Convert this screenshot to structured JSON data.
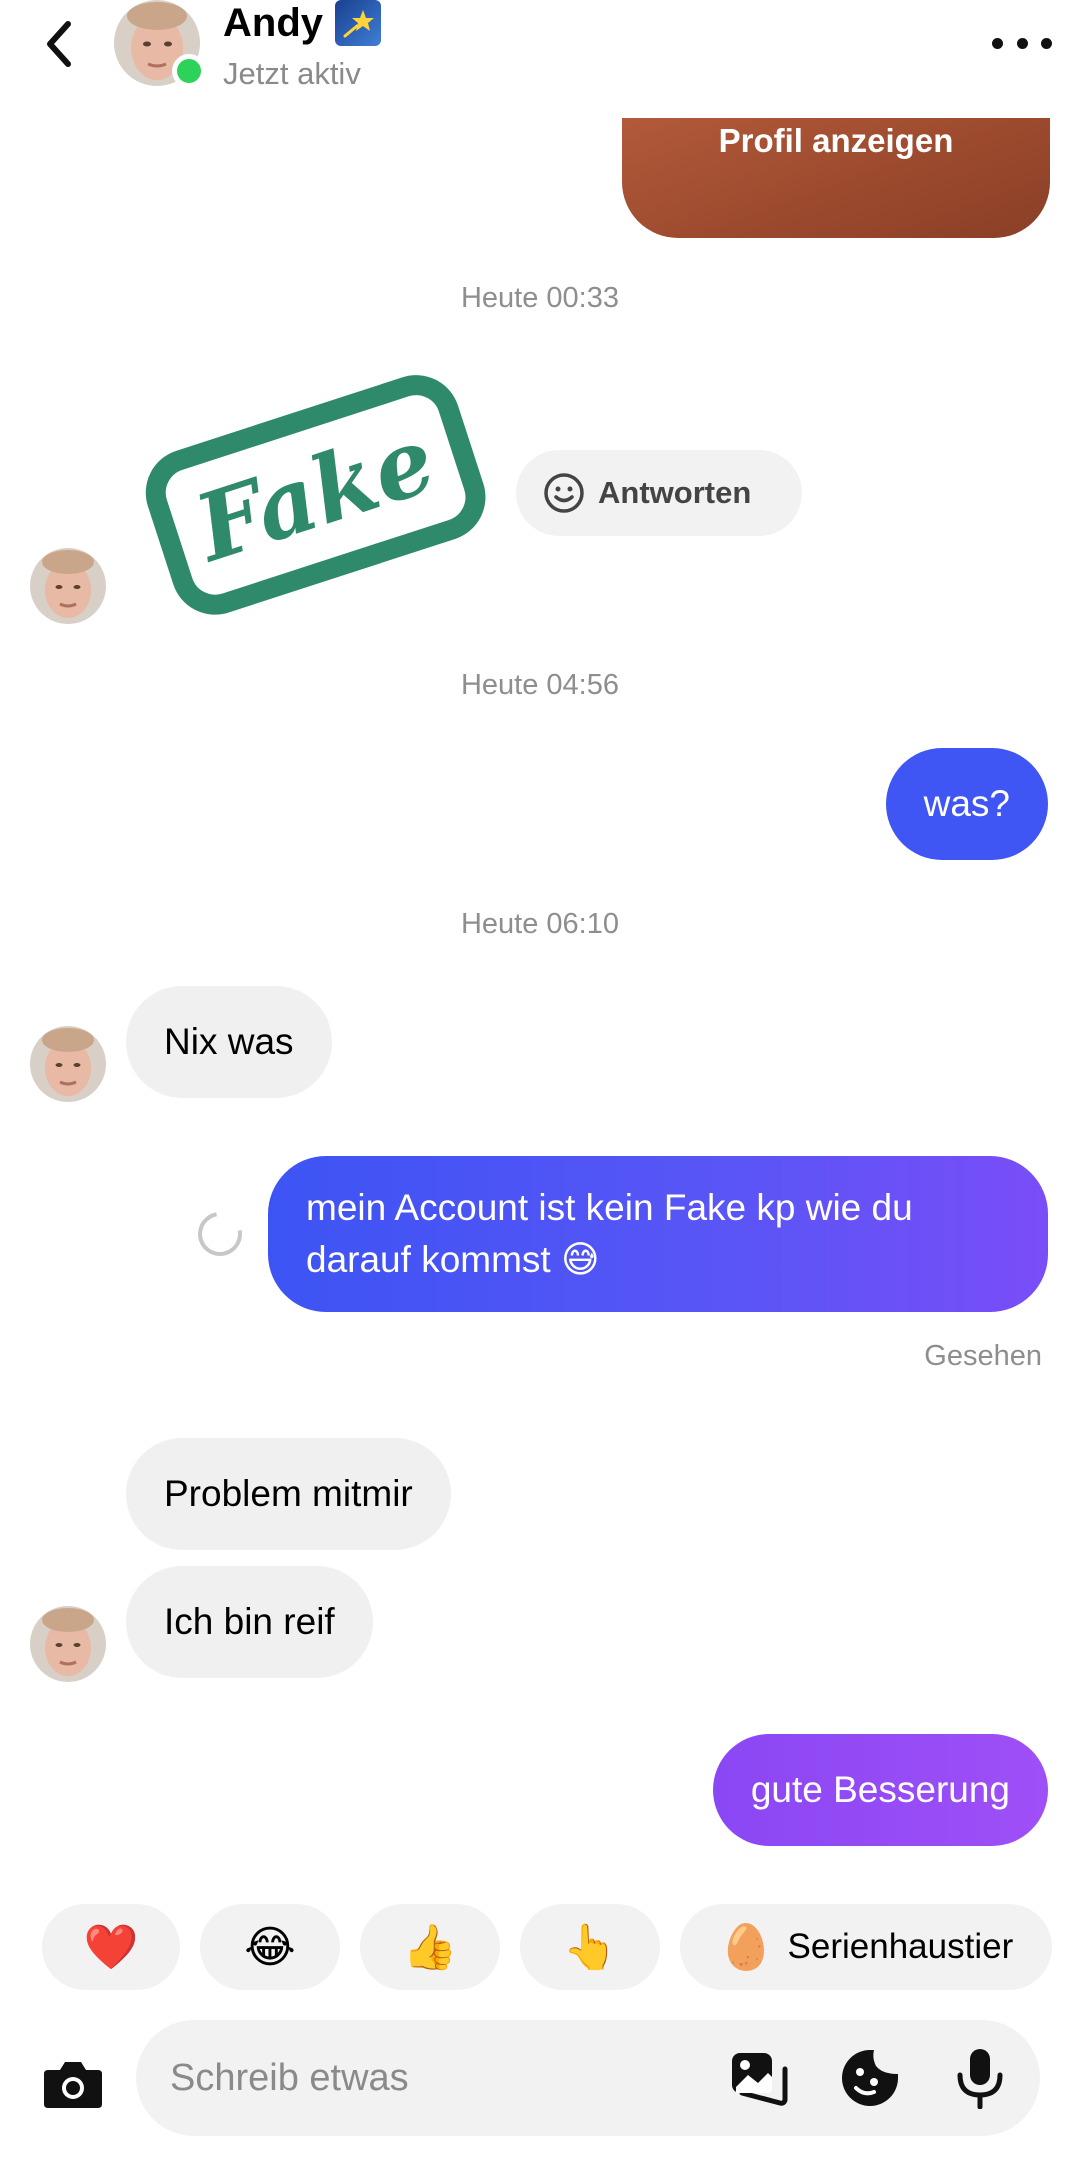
{
  "header": {
    "name": "Andy",
    "name_badge_icon": "shooting-star-emoji",
    "status": "Jetzt aktiv",
    "back_icon": "chevron-left-icon",
    "more_icon": "more-horizontal-icon"
  },
  "profile_card": {
    "label": "Profil anzeigen"
  },
  "timestamps": [
    "Heute 00:33",
    "Heute 04:56",
    "Heute 06:10"
  ],
  "sticker": {
    "text": "Fake",
    "color": "#2e8a6a"
  },
  "reply_pill": {
    "label": "Antworten",
    "icon": "smiley-icon"
  },
  "messages": [
    {
      "from": "me",
      "text": "was?"
    },
    {
      "from": "them",
      "text": "Nix was"
    },
    {
      "from": "me",
      "text": "mein Account ist kein Fake kp wie du darauf kommst 😅"
    },
    {
      "from": "them",
      "text": "Problem mitmir"
    },
    {
      "from": "them",
      "text": "Ich bin reif"
    },
    {
      "from": "me",
      "text": "gute Besserung"
    }
  ],
  "seen_label": "Gesehen",
  "quick_reactions": [
    {
      "emoji": "❤️",
      "icon": "red-heart-emoji"
    },
    {
      "emoji": "😂",
      "icon": "tears-of-joy-emoji"
    },
    {
      "emoji": "👍",
      "icon": "thumbs-up-emoji"
    },
    {
      "emoji": "👆",
      "icon": "pointing-up-emoji"
    },
    {
      "emoji": "🥚",
      "icon": "egg-emoji",
      "label": "Serienhaustier"
    }
  ],
  "composer": {
    "placeholder": "Schreib etwas",
    "camera_icon": "camera-icon",
    "gallery_icon": "gallery-icon",
    "sticker_icon": "sticker-icon",
    "mic_icon": "microphone-icon"
  },
  "colors": {
    "online": "#2dd25b",
    "bubble_incoming": "#f0f0f0",
    "bubble_blue": "#3d5afe",
    "bubble_purple": "#9a4af7",
    "timestamp": "#8e8e8e"
  }
}
